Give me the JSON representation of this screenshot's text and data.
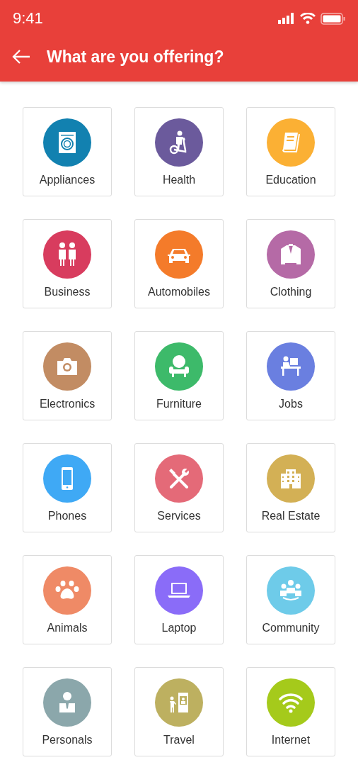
{
  "status_bar": {
    "time": "9:41"
  },
  "header": {
    "title": "What are you offering?"
  },
  "categories": [
    {
      "label": "Appliances",
      "color": "#1281b0"
    },
    {
      "label": "Health",
      "color": "#6b5a9c"
    },
    {
      "label": "Education",
      "color": "#fbb034"
    },
    {
      "label": "Business",
      "color": "#d83c5e"
    },
    {
      "label": "Automobiles",
      "color": "#f47b2a"
    },
    {
      "label": "Clothing",
      "color": "#b56aa6"
    },
    {
      "label": "Electronics",
      "color": "#c28c63"
    },
    {
      "label": "Furniture",
      "color": "#3dba6a"
    },
    {
      "label": "Jobs",
      "color": "#6a7fe0"
    },
    {
      "label": "Phones",
      "color": "#3fa9f5"
    },
    {
      "label": "Services",
      "color": "#e46a78"
    },
    {
      "label": "Real Estate",
      "color": "#d3b055"
    },
    {
      "label": "Animals",
      "color": "#ef8a66"
    },
    {
      "label": "Laptop",
      "color": "#8a6cf8"
    },
    {
      "label": "Community",
      "color": "#6ecbe9"
    },
    {
      "label": "Personals",
      "color": "#8ba7ab"
    },
    {
      "label": "Travel",
      "color": "#bdb060"
    },
    {
      "label": "Internet",
      "color": "#a5ca1b"
    }
  ]
}
